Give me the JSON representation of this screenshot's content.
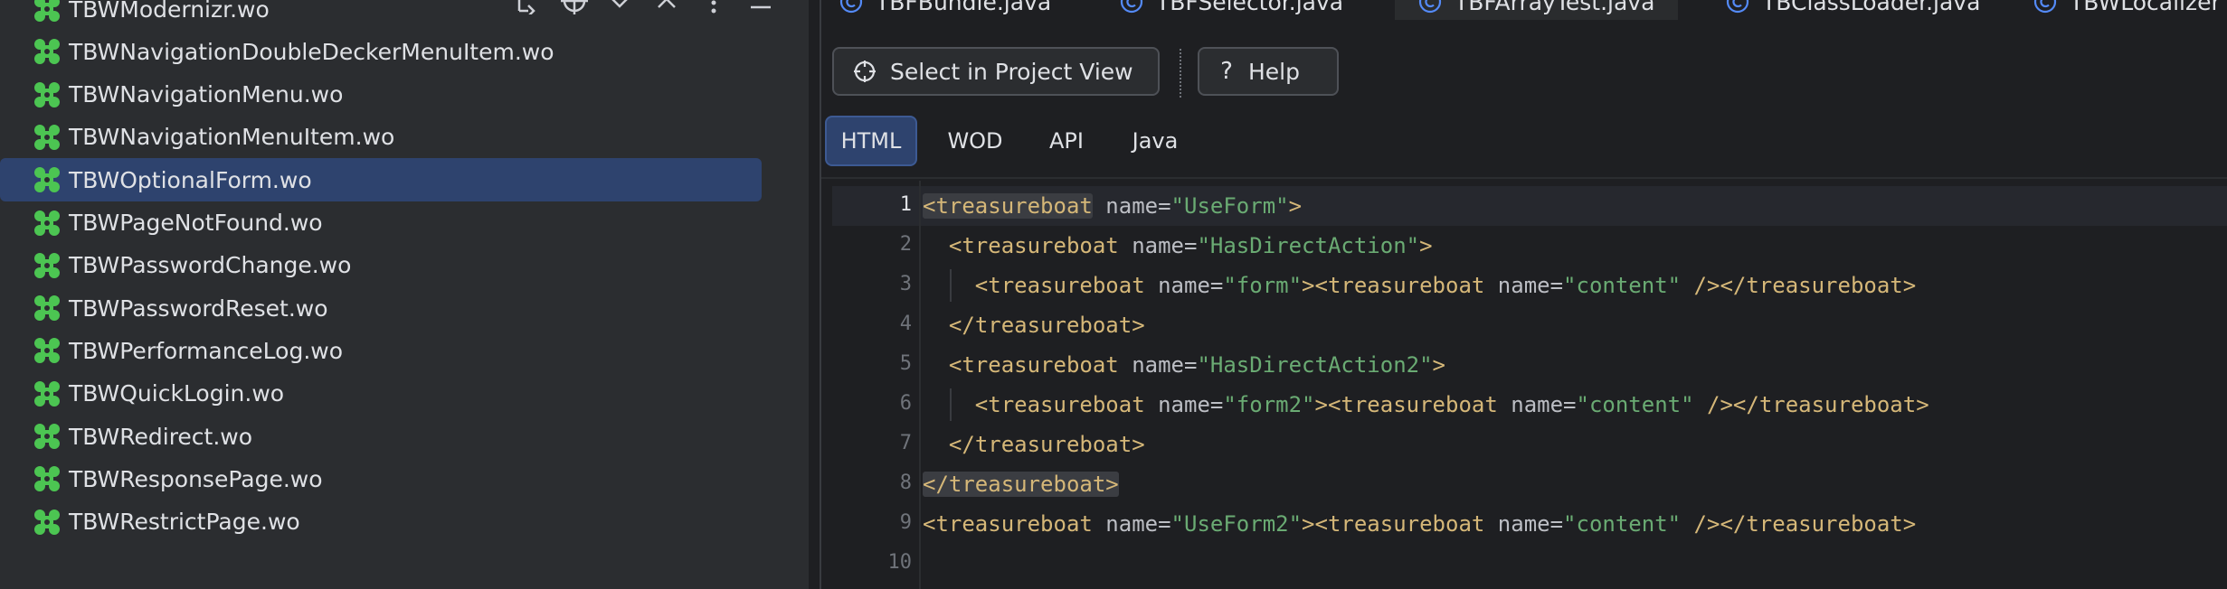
{
  "colors": {
    "panel_bg": "#2b2d30",
    "editor_bg": "#1e1f22",
    "selection": "#2e436e",
    "tag": "#d5b778",
    "string": "#6aab73",
    "attribute": "#bcbec4",
    "wo_icon": "#4cc552",
    "class_icon": "#548af7"
  },
  "project_tree": {
    "toolbar_icons": [
      "expand-icon",
      "crosshair-icon",
      "chevron-down-icon",
      "chevron-up-icon",
      "more-icon",
      "minimize-icon"
    ],
    "items": [
      {
        "label": "TBWModernizr.wo",
        "icon": "wo-component-icon",
        "selected": false
      },
      {
        "label": "TBWNavigationDoubleDeckerMenuItem.wo",
        "icon": "wo-component-icon",
        "selected": false
      },
      {
        "label": "TBWNavigationMenu.wo",
        "icon": "wo-component-icon",
        "selected": false
      },
      {
        "label": "TBWNavigationMenuItem.wo",
        "icon": "wo-component-icon",
        "selected": false
      },
      {
        "label": "TBWOptionalForm.wo",
        "icon": "wo-component-icon",
        "selected": true
      },
      {
        "label": "TBWPageNotFound.wo",
        "icon": "wo-component-icon",
        "selected": false
      },
      {
        "label": "TBWPasswordChange.wo",
        "icon": "wo-component-icon",
        "selected": false
      },
      {
        "label": "TBWPasswordReset.wo",
        "icon": "wo-component-icon",
        "selected": false
      },
      {
        "label": "TBWPerformanceLog.wo",
        "icon": "wo-component-icon",
        "selected": false
      },
      {
        "label": "TBWQuickLogin.wo",
        "icon": "wo-component-icon",
        "selected": false
      },
      {
        "label": "TBWRedirect.wo",
        "icon": "wo-component-icon",
        "selected": false
      },
      {
        "label": "TBWResponsePage.wo",
        "icon": "wo-component-icon",
        "selected": false
      },
      {
        "label": "TBWRestrictPage.wo",
        "icon": "wo-component-icon",
        "selected": false
      }
    ]
  },
  "file_tabs": [
    {
      "label": "TBFBundle.java",
      "active": false
    },
    {
      "label": "TBFSelector.java",
      "active": false
    },
    {
      "label": "TBFArrayTest.java",
      "active": true
    },
    {
      "label": "TBClassLoader.java",
      "active": false
    },
    {
      "label": "TBWLocalizer",
      "active": false
    }
  ],
  "actions": {
    "select_in_project_view": "Select in Project View",
    "help": "Help"
  },
  "view_tabs": [
    {
      "label": "HTML",
      "active": true
    },
    {
      "label": "WOD",
      "active": false
    },
    {
      "label": "API",
      "active": false
    },
    {
      "label": "Java",
      "active": false
    }
  ],
  "editor": {
    "current_line": 1,
    "lines": [
      {
        "no": "1",
        "text": "<treasureboat name=\"UseForm\">"
      },
      {
        "no": "2",
        "text": "  <treasureboat name=\"HasDirectAction\">"
      },
      {
        "no": "3",
        "text": "    <treasureboat name=\"form\"><treasureboat name=\"content\" /></treasureboat>"
      },
      {
        "no": "4",
        "text": "  </treasureboat>"
      },
      {
        "no": "5",
        "text": "  <treasureboat name=\"HasDirectAction2\">"
      },
      {
        "no": "6",
        "text": "    <treasureboat name=\"form2\"><treasureboat name=\"content\" /></treasureboat>"
      },
      {
        "no": "7",
        "text": "  </treasureboat>"
      },
      {
        "no": "8",
        "text": "</treasureboat>"
      },
      {
        "no": "9",
        "text": "<treasureboat name=\"UseForm2\"><treasureboat name=\"content\" /></treasureboat>"
      },
      {
        "no": "10",
        "text": ""
      }
    ]
  }
}
